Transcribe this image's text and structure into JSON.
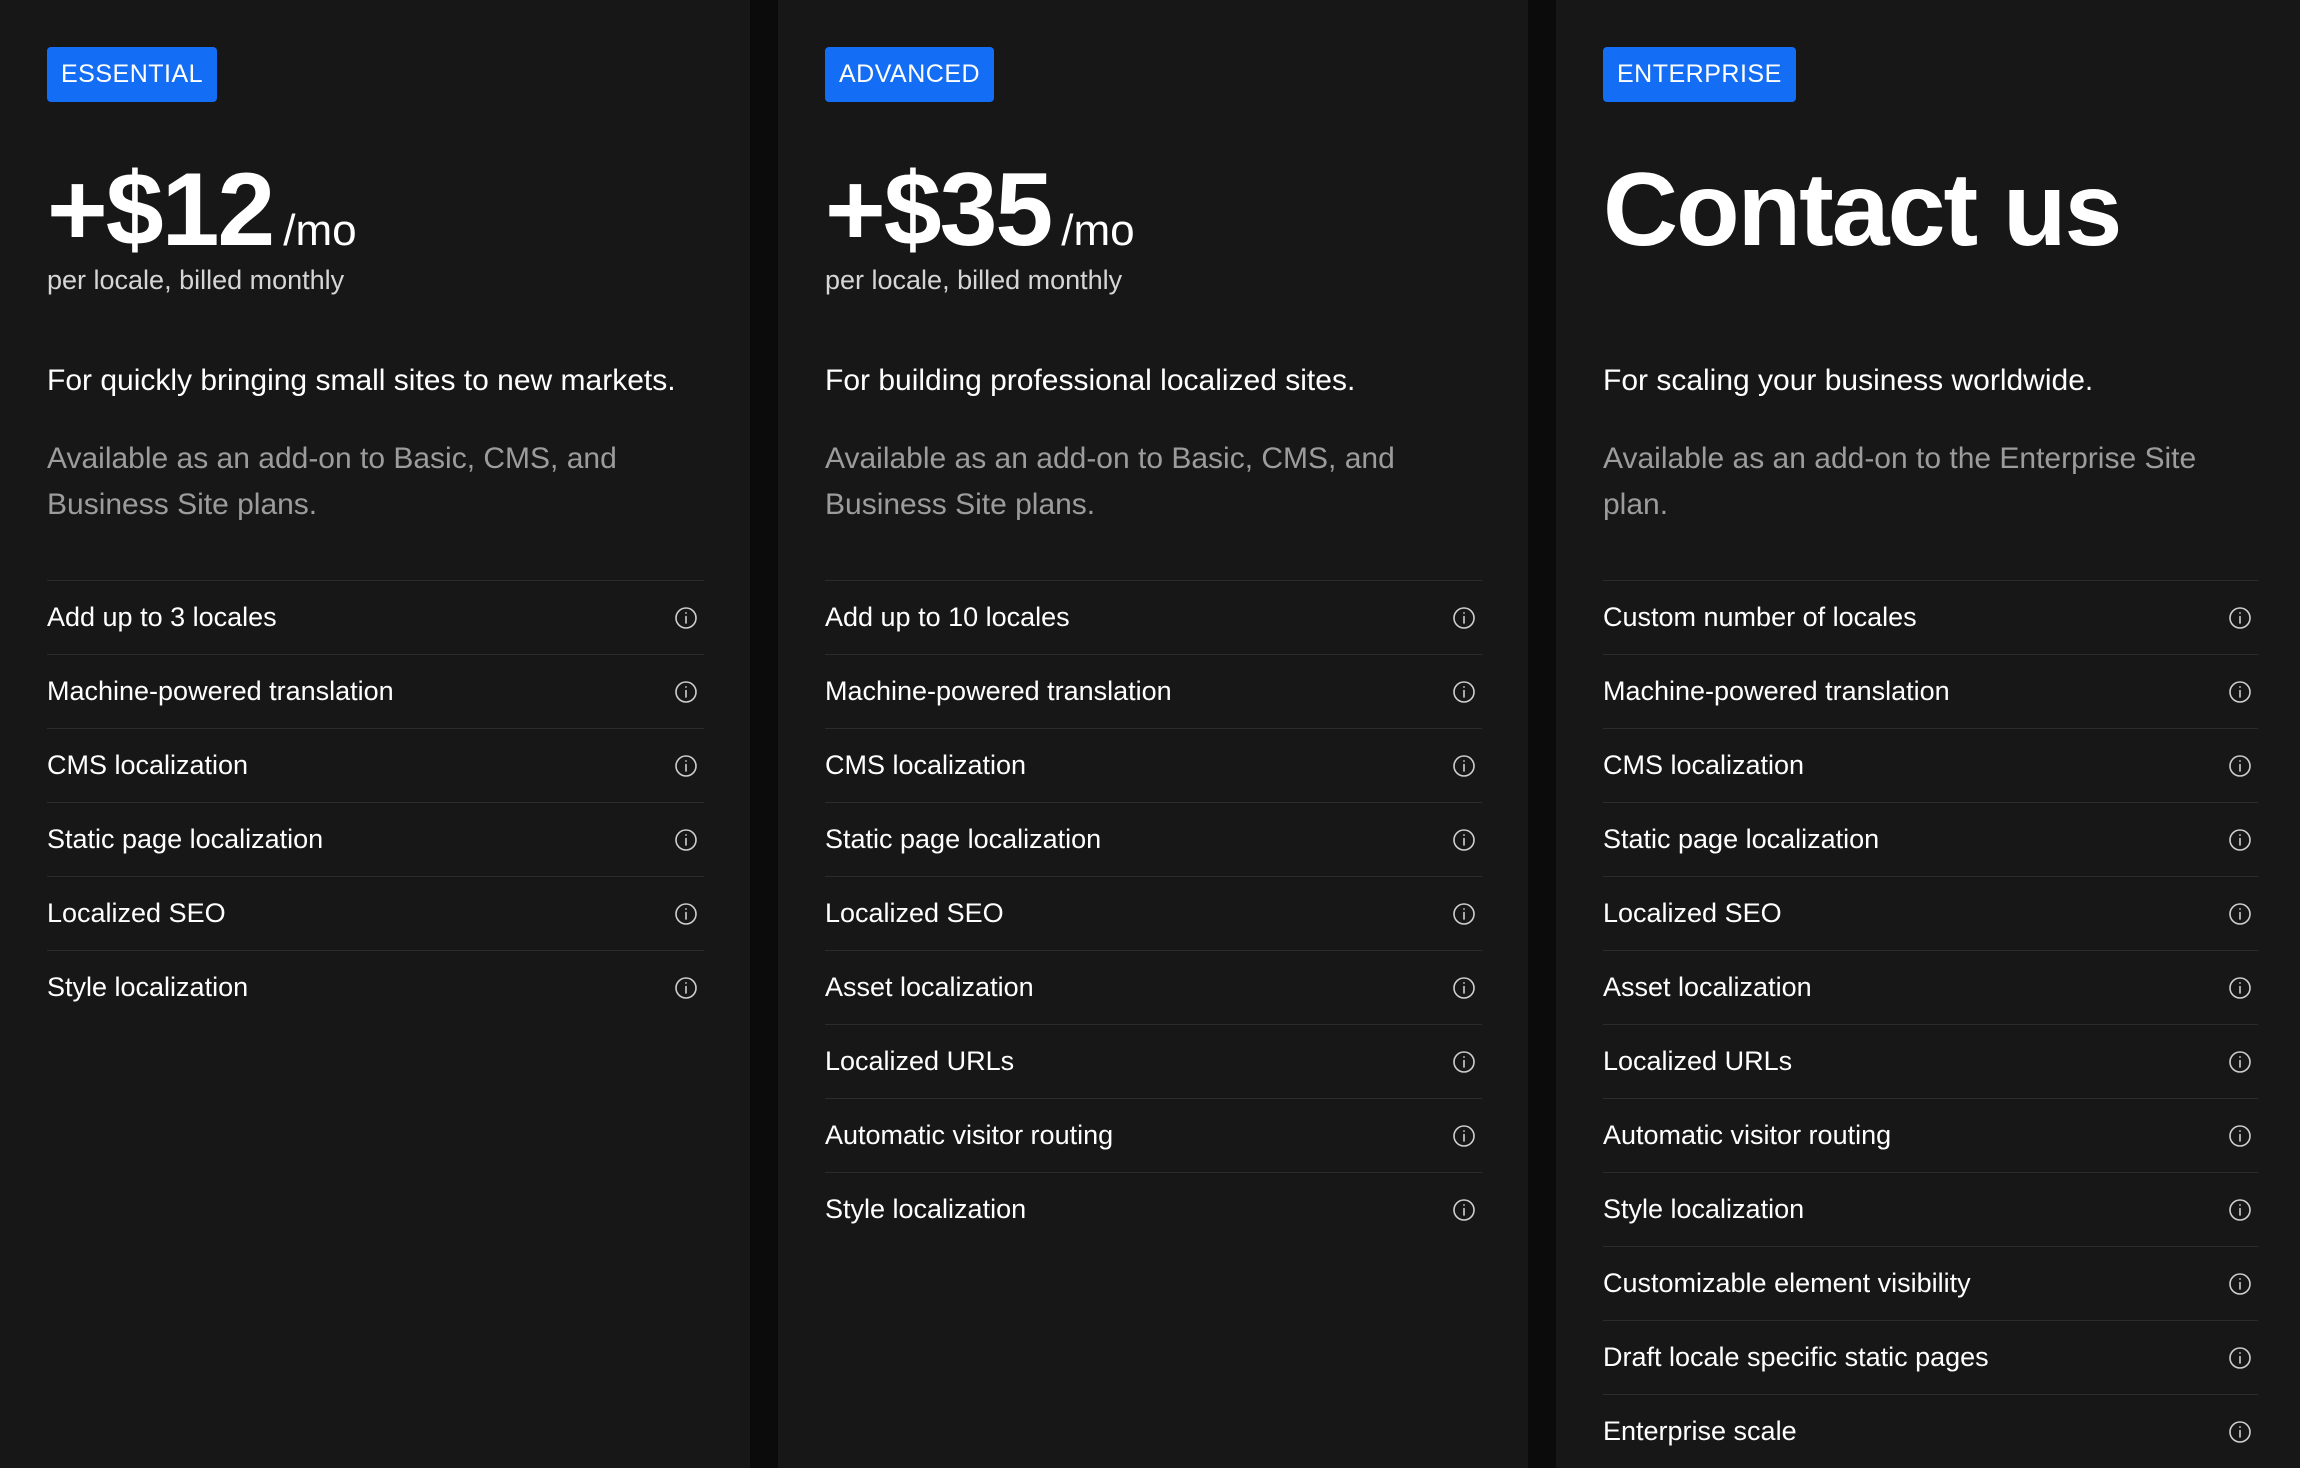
{
  "plans": [
    {
      "badge": "ESSENTIAL",
      "price": "+$12",
      "unit": "/mo",
      "billing": "per locale, billed monthly",
      "tagline": "For quickly bringing small sites to new markets.",
      "availability": "Available as an add-on to Basic, CMS, and Business Site plans.",
      "features": [
        "Add up to 3 locales",
        "Machine-powered translation",
        "CMS localization",
        "Static page localization",
        "Localized SEO",
        "Style localization"
      ]
    },
    {
      "badge": "ADVANCED",
      "price": "+$35",
      "unit": "/mo",
      "billing": "per locale, billed monthly",
      "tagline": "For building professional localized sites.",
      "availability": "Available as an add-on to Basic, CMS, and Business Site plans.",
      "features": [
        "Add up to 10 locales",
        "Machine-powered translation",
        "CMS localization",
        "Static page localization",
        "Localized SEO",
        "Asset localization",
        "Localized URLs",
        "Automatic visitor routing",
        "Style localization"
      ]
    },
    {
      "badge": "ENTERPRISE",
      "price": "Contact us",
      "tagline": "For scaling your business worldwide.",
      "availability": "Available as an add-on to the Enterprise Site plan.",
      "features": [
        "Custom number of locales",
        "Machine-powered translation",
        "CMS localization",
        "Static page localization",
        "Localized SEO",
        "Asset localization",
        "Localized URLs",
        "Automatic visitor routing",
        "Style localization",
        "Customizable element visibility",
        "Draft locale specific static pages",
        "Enterprise scale"
      ]
    }
  ],
  "icons": {
    "feature_info": "info-circle-icon"
  },
  "colors": {
    "badge": "#146ef5",
    "card": "#171718",
    "page": "#0b0b0b",
    "muted_text": "#9c9c9c"
  }
}
